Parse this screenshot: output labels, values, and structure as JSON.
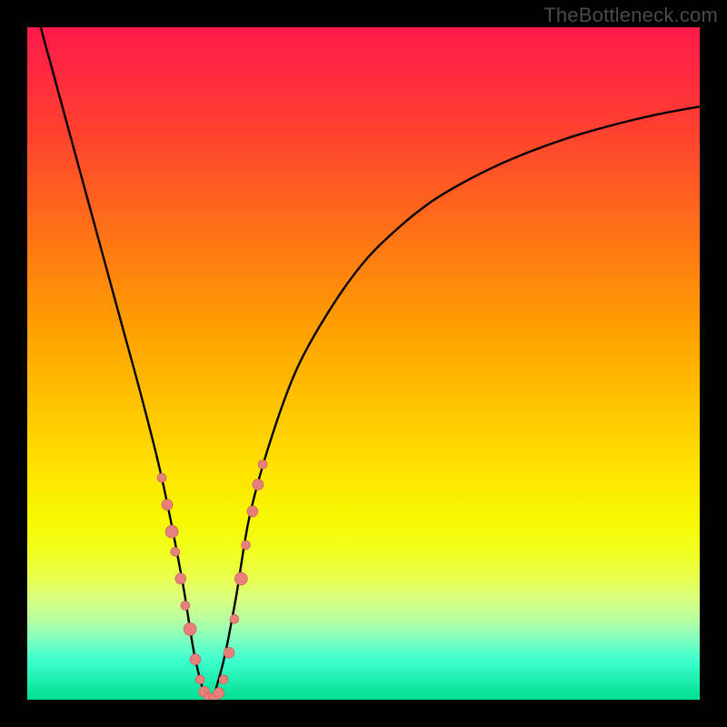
{
  "watermark": "TheBottleneck.com",
  "colors": {
    "frame": "#000000",
    "curve": "#000000",
    "dot_fill": "#e77f7b",
    "dot_stroke": "#c05a56",
    "gradient_top": "#ff1a4a",
    "gradient_bottom": "#00e090"
  },
  "chart_data": {
    "type": "line",
    "title": "",
    "xlabel": "",
    "ylabel": "",
    "xlim": [
      0,
      100
    ],
    "ylim": [
      0,
      100
    ],
    "note": "V-shaped bottleneck curve; minimum (~0) near x≈27. Values estimated from pixel positions.",
    "series": [
      {
        "name": "bottleneck-curve",
        "x": [
          2,
          5,
          8,
          11,
          14,
          17,
          20,
          23,
          25,
          27,
          29,
          31,
          33,
          36,
          40,
          45,
          50,
          55,
          60,
          65,
          70,
          75,
          80,
          85,
          90,
          95,
          100
        ],
        "y": [
          100,
          89,
          78,
          67,
          56,
          45,
          33,
          18,
          6,
          0,
          5,
          15,
          27,
          38,
          49,
          58,
          65,
          70,
          74,
          77,
          79.5,
          81.6,
          83.4,
          84.9,
          86.2,
          87.3,
          88.2
        ]
      }
    ],
    "scatter": {
      "name": "highlight-dots",
      "points": [
        {
          "x": 20.0,
          "y": 33.0,
          "r": 5
        },
        {
          "x": 20.8,
          "y": 29.0,
          "r": 6
        },
        {
          "x": 21.5,
          "y": 25.0,
          "r": 7
        },
        {
          "x": 22.0,
          "y": 22.0,
          "r": 5
        },
        {
          "x": 22.8,
          "y": 18.0,
          "r": 6
        },
        {
          "x": 23.5,
          "y": 14.0,
          "r": 5
        },
        {
          "x": 24.2,
          "y": 10.5,
          "r": 7
        },
        {
          "x": 25.0,
          "y": 6.0,
          "r": 6
        },
        {
          "x": 25.7,
          "y": 3.0,
          "r": 5
        },
        {
          "x": 26.3,
          "y": 1.2,
          "r": 6
        },
        {
          "x": 27.0,
          "y": 0.4,
          "r": 5
        },
        {
          "x": 27.8,
          "y": 0.4,
          "r": 5
        },
        {
          "x": 28.5,
          "y": 1.0,
          "r": 6
        },
        {
          "x": 29.2,
          "y": 3.0,
          "r": 5
        },
        {
          "x": 30.0,
          "y": 7.0,
          "r": 6
        },
        {
          "x": 30.8,
          "y": 12.0,
          "r": 5
        },
        {
          "x": 31.8,
          "y": 18.0,
          "r": 7
        },
        {
          "x": 32.5,
          "y": 23.0,
          "r": 5
        },
        {
          "x": 33.5,
          "y": 28.0,
          "r": 6
        },
        {
          "x": 34.3,
          "y": 32.0,
          "r": 6
        },
        {
          "x": 35.0,
          "y": 35.0,
          "r": 5
        }
      ]
    }
  }
}
